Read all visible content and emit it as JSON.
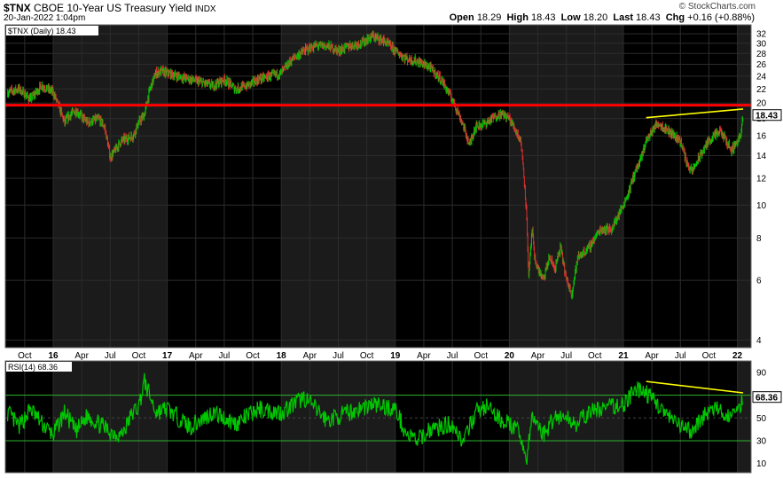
{
  "header": {
    "symbol": "$TNX",
    "name": "CBOE 10-Year US Treasury Yield",
    "exchange": "INDX",
    "datetime": "20-Jan-2022 1:04pm",
    "copyright": "© StockCharts.com",
    "quote": {
      "open_label": "Open",
      "open": "18.29",
      "high_label": "High",
      "high": "18.43",
      "low_label": "Low",
      "low": "18.20",
      "last_label": "Last",
      "last": "18.43",
      "chg_label": "Chg",
      "chg": "+0.16 (+0.88%)"
    }
  },
  "chart_data": [
    {
      "type": "bar",
      "scale": "log",
      "legend": "$TNX (Daily) 18.43",
      "last_value_label": "18.43",
      "ylim": [
        3.8,
        34
      ],
      "yticks": [
        4,
        6,
        8,
        10,
        12,
        14,
        16,
        18,
        20,
        22,
        24,
        26,
        28,
        30,
        32
      ],
      "x_tick_labels": [
        "Oct",
        "16",
        "Apr",
        "Jul",
        "Oct",
        "17",
        "Apr",
        "Jul",
        "Oct",
        "18",
        "Apr",
        "Jul",
        "Oct",
        "19",
        "Apr",
        "Jul",
        "Oct",
        "20",
        "Apr",
        "Jul",
        "Oct",
        "21",
        "Apr",
        "Jul",
        "Oct",
        "22"
      ],
      "x_tick_times": [
        2015.75,
        2016.0,
        2016.25,
        2016.5,
        2016.75,
        2017.0,
        2017.25,
        2017.5,
        2017.75,
        2018.0,
        2018.25,
        2018.5,
        2018.75,
        2019.0,
        2019.25,
        2019.5,
        2019.75,
        2020.0,
        2020.25,
        2020.5,
        2020.75,
        2021.0,
        2021.25,
        2021.5,
        2021.75,
        2022.0
      ],
      "xlim": [
        2015.58,
        2022.12
      ],
      "shaded_years": [
        [
          2016.0,
          2017.0
        ],
        [
          2018.0,
          2019.0
        ],
        [
          2020.0,
          2021.0
        ],
        [
          2022.0,
          2022.12
        ]
      ],
      "series": [
        {
          "x": [
            2015.6,
            2015.7,
            2015.8,
            2015.9,
            2015.95,
            2016.0,
            2016.05,
            2016.1,
            2016.15,
            2016.2,
            2016.3,
            2016.4,
            2016.45,
            2016.5,
            2016.6,
            2016.7,
            2016.75,
            2016.8,
            2016.85,
            2016.9,
            2016.95,
            2017.0,
            2017.2,
            2017.4,
            2017.5,
            2017.6,
            2017.7,
            2017.8,
            2017.9,
            2018.0,
            2018.1,
            2018.2,
            2018.3,
            2018.4,
            2018.5,
            2018.6,
            2018.7,
            2018.8,
            2018.9,
            2019.0,
            2019.1,
            2019.2,
            2019.3,
            2019.4,
            2019.5,
            2019.6,
            2019.65,
            2019.7,
            2019.8,
            2019.9,
            2019.95,
            2020.0,
            2020.1,
            2020.13,
            2020.15,
            2020.17,
            2020.2,
            2020.22,
            2020.25,
            2020.3,
            2020.35,
            2020.4,
            2020.45,
            2020.5,
            2020.55,
            2020.6,
            2020.7,
            2020.75,
            2020.8,
            2020.9,
            2021.0,
            2021.05,
            2021.1,
            2021.15,
            2021.2,
            2021.25,
            2021.3,
            2021.35,
            2021.4,
            2021.45,
            2021.5,
            2021.55,
            2021.6,
            2021.65,
            2021.7,
            2021.75,
            2021.8,
            2021.85,
            2021.9,
            2021.95,
            2022.0,
            2022.03,
            2022.05
          ],
          "y": [
            21.5,
            22.0,
            20.5,
            22.5,
            22.0,
            21.5,
            19.5,
            17.5,
            18.5,
            19.0,
            17.5,
            18.0,
            17.0,
            13.8,
            15.5,
            16.0,
            17.5,
            18.5,
            22.0,
            24.5,
            24.8,
            24.5,
            23.5,
            22.5,
            23.5,
            22.0,
            22.5,
            23.5,
            24.0,
            24.5,
            27.0,
            28.5,
            29.5,
            29.5,
            28.5,
            29.5,
            30.0,
            31.5,
            30.5,
            28.5,
            27.0,
            26.5,
            25.5,
            23.5,
            20.5,
            17.0,
            15.0,
            17.0,
            17.5,
            18.5,
            18.5,
            18.0,
            15.5,
            12.0,
            9.5,
            6.0,
            8.5,
            7.0,
            6.5,
            6.0,
            7.0,
            6.5,
            7.5,
            6.0,
            5.5,
            7.0,
            7.5,
            8.0,
            8.5,
            8.5,
            10.0,
            11.0,
            12.5,
            13.5,
            15.5,
            16.5,
            17.5,
            17.0,
            16.5,
            16.0,
            15.5,
            13.5,
            12.5,
            13.5,
            14.5,
            15.5,
            16.0,
            16.5,
            15.5,
            14.5,
            15.5,
            16.0,
            18.43
          ]
        }
      ],
      "resistance_line": {
        "y": 19.7,
        "color": "#ff0000"
      },
      "trend_line": {
        "x": [
          2021.2,
          2022.05
        ],
        "y": [
          18.1,
          19.2
        ],
        "color": "#ffff00"
      }
    },
    {
      "type": "line",
      "legend": "RSI(14) 68.36",
      "last_value_label": "68.36",
      "ylim": [
        2,
        100
      ],
      "yticks": [
        10,
        30,
        50,
        70,
        90
      ],
      "reference_lines": [
        30,
        50,
        70
      ],
      "series": [
        {
          "x": [
            2015.6,
            2015.7,
            2015.8,
            2015.9,
            2016.0,
            2016.1,
            2016.2,
            2016.3,
            2016.4,
            2016.5,
            2016.6,
            2016.7,
            2016.75,
            2016.8,
            2016.9,
            2017.0,
            2017.2,
            2017.4,
            2017.6,
            2017.8,
            2018.0,
            2018.2,
            2018.4,
            2018.6,
            2018.8,
            2019.0,
            2019.1,
            2019.2,
            2019.3,
            2019.4,
            2019.5,
            2019.6,
            2019.7,
            2019.8,
            2019.9,
            2020.0,
            2020.1,
            2020.15,
            2020.2,
            2020.25,
            2020.3,
            2020.4,
            2020.5,
            2020.6,
            2020.7,
            2020.8,
            2020.9,
            2021.0,
            2021.05,
            2021.1,
            2021.15,
            2021.2,
            2021.3,
            2021.4,
            2021.5,
            2021.6,
            2021.7,
            2021.8,
            2021.9,
            2022.0,
            2022.05
          ],
          "y": [
            55,
            42,
            58,
            45,
            35,
            55,
            38,
            52,
            45,
            38,
            35,
            55,
            60,
            82,
            55,
            58,
            42,
            55,
            45,
            58,
            55,
            68,
            48,
            55,
            62,
            58,
            35,
            30,
            40,
            42,
            45,
            28,
            55,
            60,
            50,
            45,
            35,
            12,
            50,
            45,
            35,
            52,
            50,
            45,
            55,
            58,
            60,
            62,
            68,
            72,
            76,
            72,
            62,
            50,
            42,
            38,
            52,
            58,
            52,
            55,
            68.36
          ]
        }
      ],
      "trend_line": {
        "x": [
          2021.2,
          2022.05
        ],
        "y": [
          82,
          72
        ],
        "color": "#ffff00"
      }
    }
  ]
}
